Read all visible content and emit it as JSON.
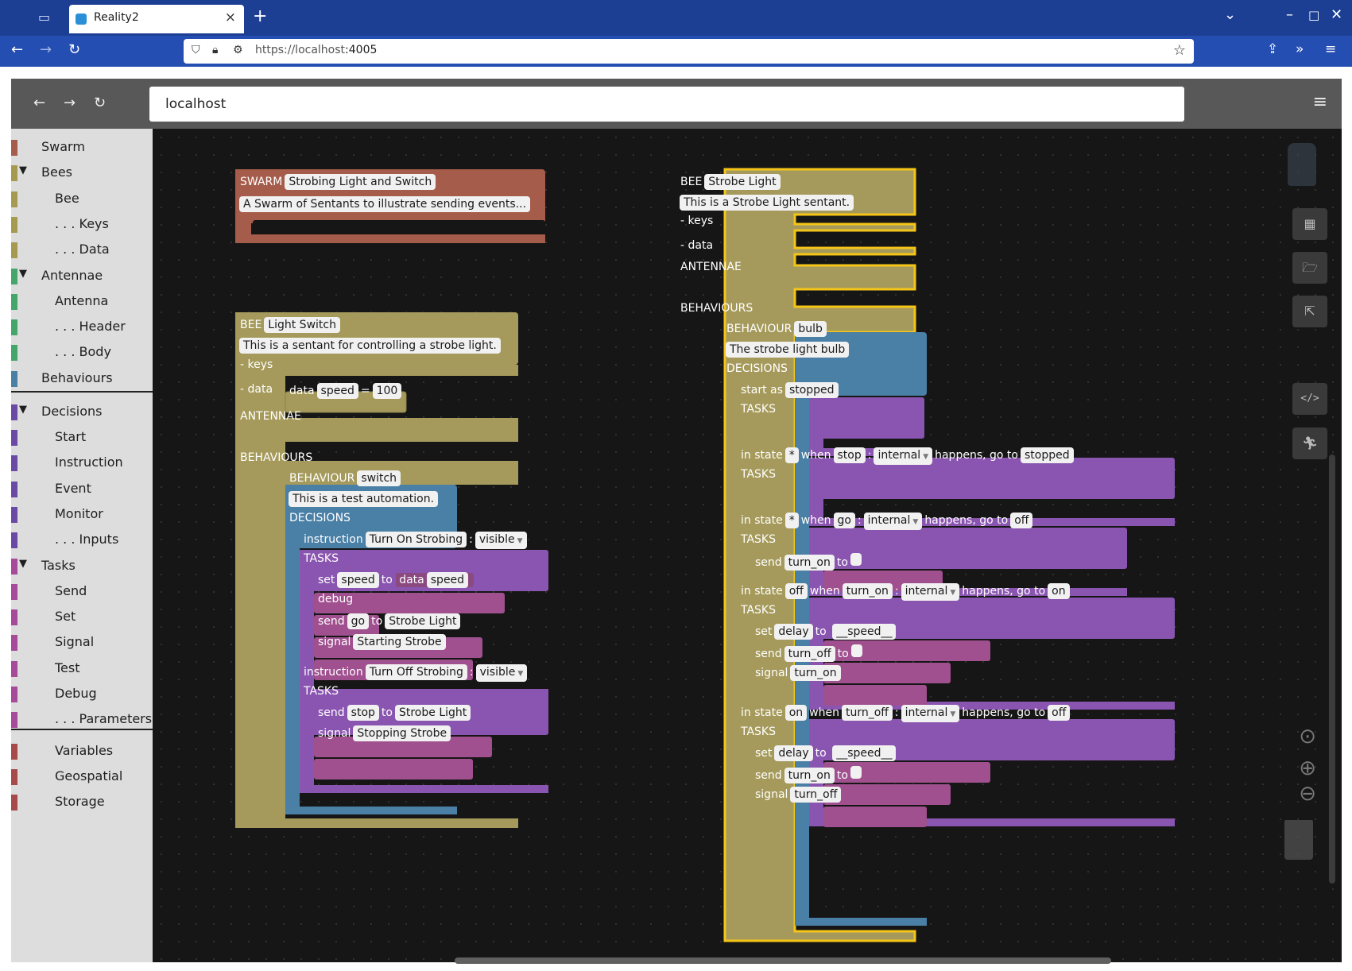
{
  "browser": {
    "tab_title": "Reality2",
    "url_host": "https://localhost",
    "url_port": ":4005",
    "new_tab_label": "+",
    "tab_close": "×"
  },
  "app": {
    "address": "localhost",
    "menu_icon": "hamburger-icon"
  },
  "toolbox": [
    {
      "label": "Swarm",
      "color": "#a65c4a"
    },
    {
      "label": "Bees",
      "color": "#a59a4f",
      "expanded": true
    },
    {
      "label": "Bee",
      "color": "#a59a4f"
    },
    {
      "label": ". . . Keys",
      "color": "#a59a4f"
    },
    {
      "label": ". . . Data",
      "color": "#a59a4f"
    },
    {
      "label": "Antennae",
      "color": "#45a66b",
      "expanded": true
    },
    {
      "label": "Antenna",
      "color": "#45a66b"
    },
    {
      "label": ". . . Header",
      "color": "#45a66b"
    },
    {
      "label": ". . . Body",
      "color": "#45a66b"
    },
    {
      "label": "Behaviours",
      "color": "#4a7fa6"
    },
    {
      "label": "Decisions",
      "color": "#6b4aa6",
      "expanded": true
    },
    {
      "label": "Start",
      "color": "#6b4aa6"
    },
    {
      "label": "Instruction",
      "color": "#6b4aa6"
    },
    {
      "label": "Event",
      "color": "#6b4aa6"
    },
    {
      "label": "Monitor",
      "color": "#6b4aa6"
    },
    {
      "label": ". . . Inputs",
      "color": "#6b4aa6"
    },
    {
      "label": "Tasks",
      "color": "#a64a9a",
      "expanded": true
    },
    {
      "label": "Send",
      "color": "#a64a9a"
    },
    {
      "label": "Set",
      "color": "#a64a9a"
    },
    {
      "label": "Signal",
      "color": "#a64a9a"
    },
    {
      "label": "Test",
      "color": "#a64a9a"
    },
    {
      "label": "Debug",
      "color": "#a64a9a"
    },
    {
      "label": ". . . Parameters",
      "color": "#a64a9a"
    },
    {
      "label": "Variables",
      "color": "#a64a4a"
    },
    {
      "label": "Geospatial",
      "color": "#a64a4a"
    },
    {
      "label": "Storage",
      "color": "#a64a4a"
    }
  ],
  "blocks": {
    "swarm": {
      "kw": "SWARM",
      "name": "Strobing Light and Switch",
      "desc": "A Swarm of Sentants to illustrate sending events..."
    },
    "bee1": {
      "kw": "BEE",
      "name": "Light Switch",
      "desc": "This is a sentant for controlling a strobe light.",
      "keys": "- keys",
      "data": "- data",
      "data_kw": "data",
      "data_var": "speed",
      "data_eq": "=",
      "data_val": "100",
      "antennae": "ANTENNAE",
      "behaviours": "BEHAVIOURS"
    },
    "beh1": {
      "kw": "BEHAVIOUR",
      "name": "switch",
      "desc": "This is a test automation.",
      "decisions": "DECISIONS"
    },
    "instr1": {
      "kw": "instruction",
      "name": "Turn On Strobing",
      "colon": ":",
      "vis": "visible",
      "tasks": "TASKS",
      "set_kw": "set",
      "set_var": "speed",
      "set_to": "to",
      "set_data": "data",
      "set_val": "speed",
      "debug": "debug",
      "send_kw": "send",
      "send_evt": "go",
      "send_to": "to",
      "send_target": "Strobe Light",
      "signal_kw": "signal",
      "signal_val": "Starting Strobe"
    },
    "instr2": {
      "kw": "instruction",
      "name": "Turn Off Strobing",
      "colon": ":",
      "vis": "visible",
      "tasks": "TASKS",
      "send_kw": "send",
      "send_evt": "stop",
      "send_to": "to",
      "send_target": "Strobe Light",
      "signal_kw": "signal",
      "signal_val": "Stopping Strobe"
    },
    "bee2": {
      "kw": "BEE",
      "name": "Strobe Light",
      "desc": "This is a Strobe Light sentant.",
      "keys": "- keys",
      "data": "- data",
      "antennae": "ANTENNAE",
      "behaviours": "BEHAVIOURS"
    },
    "beh2": {
      "kw": "BEHAVIOUR",
      "name": "bulb",
      "desc": "The strobe light bulb",
      "decisions": "DECISIONS"
    },
    "start": {
      "kw": "start as",
      "state": "stopped",
      "tasks": "TASKS"
    },
    "ev1": {
      "in_state": "in state",
      "from": "*",
      "when": "when",
      "evt": "stop",
      "colon": ":",
      "src": "internal",
      "happens": "happens, go to",
      "to": "stopped",
      "tasks": "TASKS"
    },
    "ev2": {
      "in_state": "in state",
      "from": "*",
      "when": "when",
      "evt": "go",
      "colon": ":",
      "src": "internal",
      "happens": "happens, go to",
      "to": "off",
      "tasks": "TASKS",
      "send_kw": "send",
      "send_evt": "turn_on",
      "send_to": "to"
    },
    "ev3": {
      "in_state": "in state",
      "from": "off",
      "when": "when",
      "evt": "turn_on",
      "colon": ":",
      "src": "internal",
      "happens": "happens, go to",
      "to": "on",
      "tasks": "TASKS",
      "set_kw": "set",
      "set_var": "delay",
      "set_to": "to",
      "set_val": "__speed__",
      "send_kw": "send",
      "send_evt": "turn_off",
      "send_to": "to",
      "signal_kw": "signal",
      "signal_val": "turn_on"
    },
    "ev4": {
      "in_state": "in state",
      "from": "on",
      "when": "when",
      "evt": "turn_off",
      "colon": ":",
      "src": "internal",
      "happens": "happens, go to",
      "to": "off",
      "tasks": "TASKS",
      "set_kw": "set",
      "set_var": "delay",
      "set_to": "to",
      "set_val": "__speed__",
      "send_kw": "send",
      "send_evt": "turn_on",
      "send_to": "to",
      "signal_kw": "signal",
      "signal_val": "turn_off"
    }
  },
  "colors": {
    "swarm": "#a65c4a",
    "bee": "#a59a5b",
    "behaviour": "#4a80a6",
    "decision": "#8a55b0",
    "task": "#a0508f",
    "selected": "#f5c518"
  }
}
